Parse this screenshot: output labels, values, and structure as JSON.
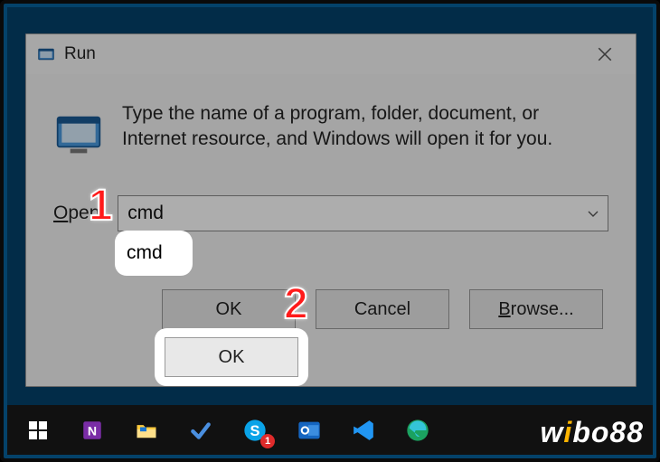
{
  "dialog": {
    "title": "Run",
    "prompt": "Type the name of a program, folder, document, or Internet resource, and Windows will open it for you.",
    "open_label_prefix": "O",
    "open_label_rest": "pen:",
    "input_value": "cmd",
    "buttons": {
      "ok": "OK",
      "cancel": "Cancel",
      "browse_prefix": "B",
      "browse_rest": "rowse..."
    }
  },
  "callouts": {
    "step1": "1",
    "step2": "2"
  },
  "taskbar": {
    "items": [
      {
        "name": "start",
        "badge": null
      },
      {
        "name": "onenote",
        "badge": null
      },
      {
        "name": "file-explorer",
        "badge": null
      },
      {
        "name": "todo",
        "badge": null
      },
      {
        "name": "skype",
        "badge": "1"
      },
      {
        "name": "outlook",
        "badge": null
      },
      {
        "name": "vscode",
        "badge": null
      },
      {
        "name": "edge",
        "badge": null
      }
    ]
  },
  "watermark": {
    "part1": "w",
    "accent": "i",
    "part2": "bo88"
  }
}
